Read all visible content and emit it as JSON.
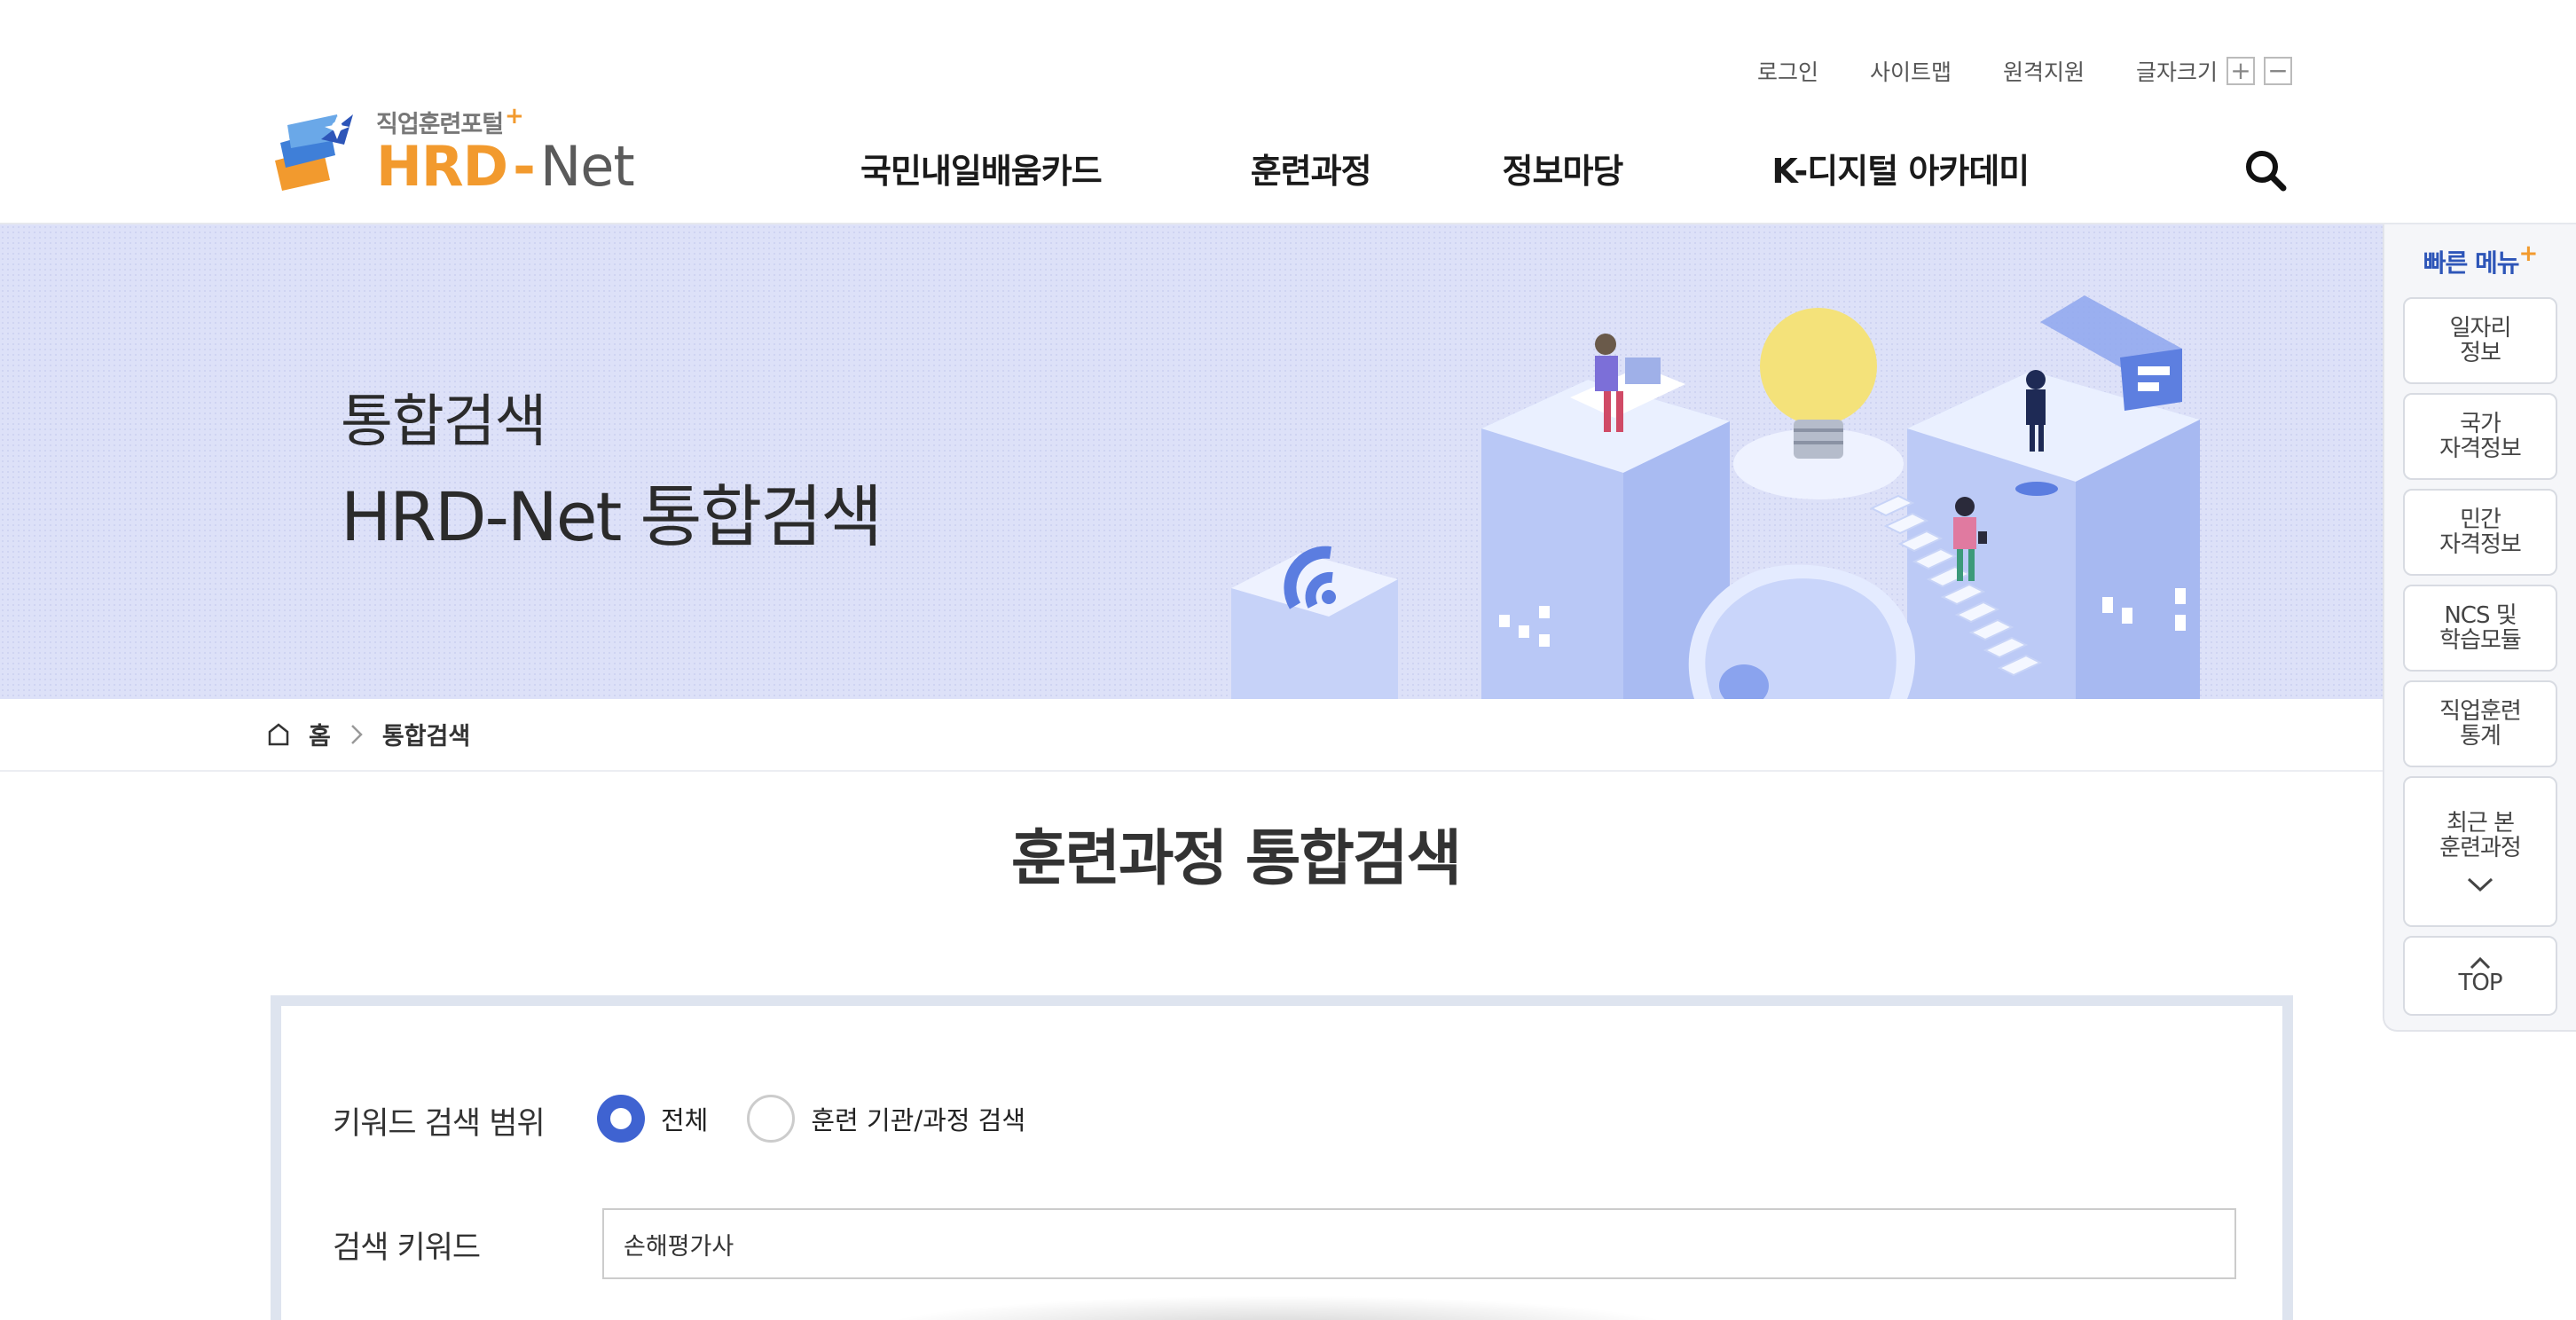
{
  "util": {
    "login": "로그인",
    "sitemap": "사이트맵",
    "remote": "원격지원",
    "fontsize_label": "글자크기",
    "fontsize_plus": "+",
    "fontsize_minus": "−"
  },
  "logo": {
    "subtitle": "직업훈련포털",
    "plus": "+",
    "hrd": "HRD",
    "dash": "-",
    "net": "Net"
  },
  "gnb": [
    {
      "label": "국민내일배움카드"
    },
    {
      "label": "훈련과정"
    },
    {
      "label": "정보마당"
    },
    {
      "label": "K-디지털 아카데미"
    }
  ],
  "hero": {
    "title": "통합검색",
    "subtitle": "HRD-Net 통합검색"
  },
  "quick": {
    "title": "빠른 메뉴",
    "plus": "+",
    "items": [
      {
        "label": "일자리\n정보"
      },
      {
        "label": "국가\n자격정보"
      },
      {
        "label": "민간\n자격정보"
      },
      {
        "label": "NCS 및\n학습모듈"
      },
      {
        "label": "직업훈련\n통계"
      }
    ],
    "recent": "최근 본\n훈련과정",
    "top": "TOP"
  },
  "breadcrumb": {
    "home": "홈",
    "current": "통합검색"
  },
  "page": {
    "title": "훈련과정 통합검색"
  },
  "search": {
    "scope_label": "키워드 검색 범위",
    "options": [
      {
        "label": "전체",
        "selected": true
      },
      {
        "label": "훈련 기관/과정 검색",
        "selected": false
      }
    ],
    "keyword_label": "검색 키워드",
    "keyword_value": "손해평가사"
  },
  "colors": {
    "brand_orange": "#f29a2e",
    "brand_blue": "#3f63d1",
    "hero_bg": "#dde1f8",
    "quick_title": "#2d55b8"
  }
}
